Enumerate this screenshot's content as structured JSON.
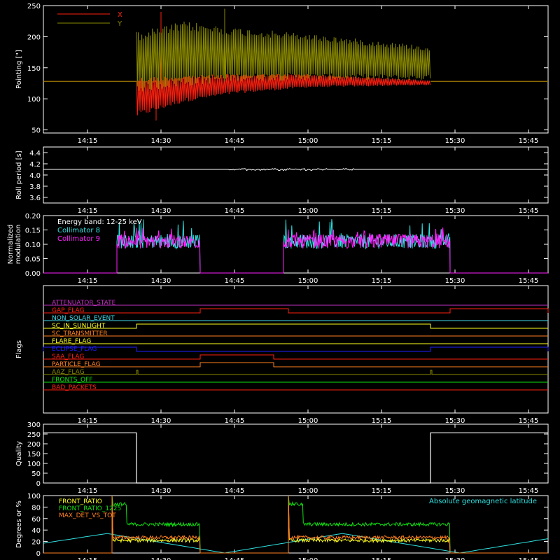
{
  "time_axis": {
    "range": [
      "14:06",
      "15:49"
    ],
    "ticks": [
      "14:15",
      "14:30",
      "14:45",
      "15:00",
      "15:15",
      "15:30",
      "15:45"
    ]
  },
  "colors": {
    "background": "#000000",
    "axes": "#ffffff",
    "red": "#ff2010",
    "olive": "#8a8a00",
    "cyan": "#30e0e0",
    "magenta": "#ff20ff",
    "green": "#10e010",
    "orange": "#ff8020",
    "yellow": "#ffff20",
    "blue": "#2020ff",
    "purple": "#c030c0",
    "light_cyan": "#40d8e8",
    "white": "#ffffff"
  },
  "chart_data": [
    {
      "type": "line",
      "ylabel": "Pointing [\"]",
      "ylim": [
        45,
        250
      ],
      "yticks": [
        "50",
        "100",
        "150",
        "200",
        "250"
      ],
      "legend_position": "top-left",
      "series": [
        {
          "name": "X",
          "color": "#ff2010",
          "baseline": 128,
          "active": [
            "14:25",
            "15:25"
          ],
          "envelope_high": [
            [
              "14:25",
              135
            ],
            [
              "14:35",
              138
            ],
            [
              "14:45",
              140
            ],
            [
              "15:00",
              140
            ],
            [
              "15:25",
              130
            ]
          ],
          "envelope_low": [
            [
              "14:25",
              70
            ],
            [
              "14:35",
              95
            ],
            [
              "14:45",
              108
            ],
            [
              "15:00",
              118
            ],
            [
              "15:25",
              122
            ]
          ],
          "spikes": [
            [
              "14:30",
              240
            ],
            [
              "14:29",
              65
            ]
          ]
        },
        {
          "name": "Y",
          "color": "#8a8a00",
          "baseline": 128,
          "active": [
            "14:25",
            "15:25"
          ],
          "envelope_high": [
            [
              "14:25",
              208
            ],
            [
              "14:35",
              225
            ],
            [
              "14:45",
              215
            ],
            [
              "15:00",
              205
            ],
            [
              "15:25",
              185
            ]
          ],
          "envelope_low": [
            [
              "14:25",
              110
            ],
            [
              "14:35",
              120
            ],
            [
              "14:45",
              128
            ],
            [
              "15:00",
              130
            ],
            [
              "15:25",
              130
            ]
          ],
          "spikes": [
            [
              "14:43",
              245
            ]
          ]
        }
      ]
    },
    {
      "type": "line",
      "ylabel": "Roll period [s]",
      "ylim": [
        3.5,
        4.5
      ],
      "yticks": [
        "3.6",
        "3.8",
        "4.0",
        "4.2",
        "4.4"
      ],
      "series": [
        {
          "color": "#ffffff",
          "value": 4.1,
          "noisy": [
            "14:43",
            "15:10"
          ]
        }
      ]
    },
    {
      "type": "line",
      "ylabel": "Normalized modulation",
      "ylim": [
        0,
        0.2
      ],
      "yticks": [
        "0.00",
        "0.05",
        "0.10",
        "0.15",
        "0.20"
      ],
      "annotation": "Energy band: 12-25 keV",
      "series": [
        {
          "name": "Collimator 8",
          "color": "#30e0e0",
          "mean": 0.11,
          "peak": 0.19,
          "intervals": [
            [
              "14:21",
              "14:38"
            ],
            [
              "14:55",
              "15:29"
            ]
          ]
        },
        {
          "name": "Collimator 9",
          "color": "#ff20ff",
          "mean": 0.11,
          "peak": 0.16,
          "intervals": [
            [
              "14:21",
              "14:38"
            ],
            [
              "14:55",
              "15:29"
            ]
          ]
        }
      ]
    },
    {
      "type": "line",
      "ylabel": "Flags",
      "flags": [
        {
          "name": "ATTENUATOR_STATE",
          "color": "#c030c0",
          "high_intervals": []
        },
        {
          "name": "GAP_FLAG",
          "color": "#ff2010",
          "high_intervals": [
            [
              "14:38",
              "14:56"
            ],
            [
              "15:29",
              "15:49"
            ]
          ]
        },
        {
          "name": "NON_SOLAR_EVENT",
          "color": "#40d8e8",
          "high_intervals": []
        },
        {
          "name": "SC_IN_SUNLIGHT",
          "color": "#ffff20",
          "high_intervals": [
            [
              "14:25",
              "15:25"
            ]
          ]
        },
        {
          "name": "SC_TRANSMITTER",
          "color": "#ff8020",
          "high_intervals": []
        },
        {
          "name": "FLARE_FLAG",
          "color": "#ffff20",
          "high_intervals": []
        },
        {
          "name": "ECLIPSE_FLAG",
          "color": "#2020ff",
          "high_intervals": [
            [
              "14:06",
              "14:25"
            ],
            [
              "15:25",
              "15:49"
            ]
          ]
        },
        {
          "name": "SAA_FLAG",
          "color": "#ff2010",
          "high_intervals": [
            [
              "14:38",
              "14:53"
            ]
          ]
        },
        {
          "name": "PARTICLE_FLAG",
          "color": "#ff8020",
          "high_intervals": [
            [
              "14:38",
              "14:53"
            ]
          ]
        },
        {
          "name": "AAZ_FLAG",
          "color": "#8a8a00",
          "high_intervals": [
            [
              "14:25",
              "14:25"
            ],
            [
              "15:25",
              "15:25"
            ]
          ]
        },
        {
          "name": "FRONTS_OFF",
          "color": "#10e010",
          "high_intervals": []
        },
        {
          "name": "BAD_PACKETS",
          "color": "#ff2010",
          "high_intervals": []
        }
      ]
    },
    {
      "type": "line",
      "ylabel": "Quality",
      "ylim": [
        0,
        300
      ],
      "yticks": [
        "0",
        "50",
        "100",
        "150",
        "200",
        "250",
        "300"
      ],
      "series": [
        {
          "color": "#ffffff",
          "points": [
            [
              "14:06",
              256
            ],
            [
              "14:25",
              256
            ],
            [
              "14:25",
              0
            ],
            [
              "15:25",
              0
            ],
            [
              "15:25",
              256
            ],
            [
              "15:49",
              256
            ]
          ]
        }
      ]
    },
    {
      "type": "line",
      "ylabel": "Degrees or %",
      "ylim": [
        0,
        100
      ],
      "yticks": [
        "0",
        "20",
        "40",
        "60",
        "80",
        "100"
      ],
      "annotation": "Absolute geomagnetic latitude",
      "series": [
        {
          "name": "FRONT_RATIO",
          "color": "#ffff20",
          "level": 22,
          "intervals": [
            [
              "14:20",
              "14:38"
            ],
            [
              "14:56",
              "15:29"
            ]
          ]
        },
        {
          "name": "FRONT_RATIO_1225",
          "color": "#10e010",
          "level": 50,
          "intervals": [
            [
              "14:20",
              "14:38"
            ],
            [
              "14:56",
              "15:29"
            ]
          ]
        },
        {
          "name": "MAX_DET_VS_TOT",
          "color": "#ff8020",
          "level": 27,
          "intervals": [
            [
              "14:20",
              "14:38"
            ],
            [
              "14:56",
              "15:29"
            ]
          ]
        },
        {
          "name": "Absolute geomagnetic latitude",
          "color": "#30e0e0",
          "points": [
            [
              "14:06",
              17
            ],
            [
              "14:19",
              34
            ],
            [
              "14:43",
              0
            ],
            [
              "15:07",
              34
            ],
            [
              "15:31",
              0
            ],
            [
              "15:49",
              25
            ]
          ]
        }
      ]
    }
  ]
}
